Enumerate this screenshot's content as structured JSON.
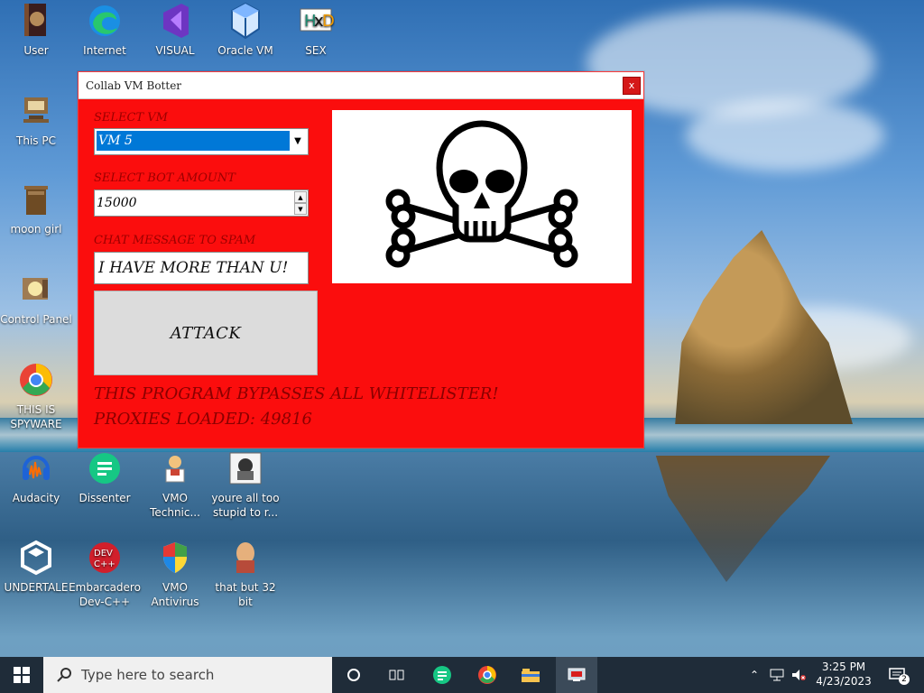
{
  "desktop": {
    "icons": [
      {
        "label": "User"
      },
      {
        "label": "Internet"
      },
      {
        "label": "VISUAL"
      },
      {
        "label": "Oracle VM"
      },
      {
        "label": "SEX"
      },
      {
        "label": "This PC"
      },
      {
        "label": "moon girl"
      },
      {
        "label": "Control Panel"
      },
      {
        "label": "THIS IS\nSPYWARE"
      },
      {
        "label": "Audacity"
      },
      {
        "label": "Dissenter"
      },
      {
        "label": "VMO\nTechnic..."
      },
      {
        "label": "youre all too\nstupid to r..."
      },
      {
        "label": "UNDERTALE"
      },
      {
        "label": "Embarcadero\nDev-C++"
      },
      {
        "label": "VMO\nAntivirus"
      },
      {
        "label": "that but 32\nbit"
      }
    ]
  },
  "window": {
    "title": "Collab VM Botter",
    "close_label": "x",
    "labels": {
      "select_vm": "SELECT VM",
      "bot_amount": "SELECT BOT AMOUNT",
      "chat_message": "CHAT MESSAGE TO SPAM"
    },
    "values": {
      "vm": "VM 5",
      "bot_amount": "15000",
      "chat_message": "I HAVE MORE THAN U!"
    },
    "attack_label": "ATTACK",
    "bypass_text": "THIS PROGRAM BYPASSES ALL WHITELISTER!",
    "proxies_text": "PROXIES LOADED: 49816"
  },
  "taskbar": {
    "search_placeholder": "Type here to search",
    "time": "3:25 PM",
    "date": "4/23/2023",
    "notification_count": "2"
  },
  "colors": {
    "window_bg": "#fb0d0d",
    "select_highlight": "#0078d7",
    "taskbar": "#1f2c39"
  }
}
